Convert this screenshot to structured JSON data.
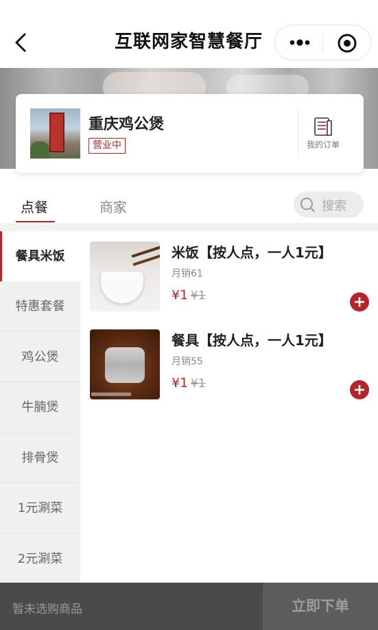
{
  "nav": {
    "title": "互联网家智慧餐厅"
  },
  "shop": {
    "name": "重庆鸡公煲",
    "status": "营业中",
    "orders_label": "我的订单"
  },
  "tabs": {
    "order": "点餐",
    "merchant": "商家",
    "search_placeholder": "搜索"
  },
  "categories": [
    {
      "label": "餐具米饭",
      "active": true
    },
    {
      "label": "特惠套餐"
    },
    {
      "label": "鸡公煲"
    },
    {
      "label": "牛腩煲"
    },
    {
      "label": "排骨煲"
    },
    {
      "label": "1元涮菜"
    },
    {
      "label": "2元涮菜"
    }
  ],
  "items": [
    {
      "name": "米饭【按人点，一人1元】",
      "sales": "月销61",
      "price": "¥1",
      "original_price": "¥1"
    },
    {
      "name": "餐具【按人点，一人1元】",
      "sales": "月销55",
      "price": "¥1",
      "original_price": "¥1"
    }
  ],
  "cart": {
    "empty_text": "暂未选购商品",
    "checkout_label": "立即下单"
  },
  "colors": {
    "accent": "#b5242a",
    "bottom_bar": "#4a4a4a",
    "checkout_bg": "#5c5c5c"
  },
  "icons": [
    "back-arrow-icon",
    "more-dots-icon",
    "target-circle-icon",
    "order-list-icon",
    "search-icon",
    "add-circle-icon"
  ]
}
